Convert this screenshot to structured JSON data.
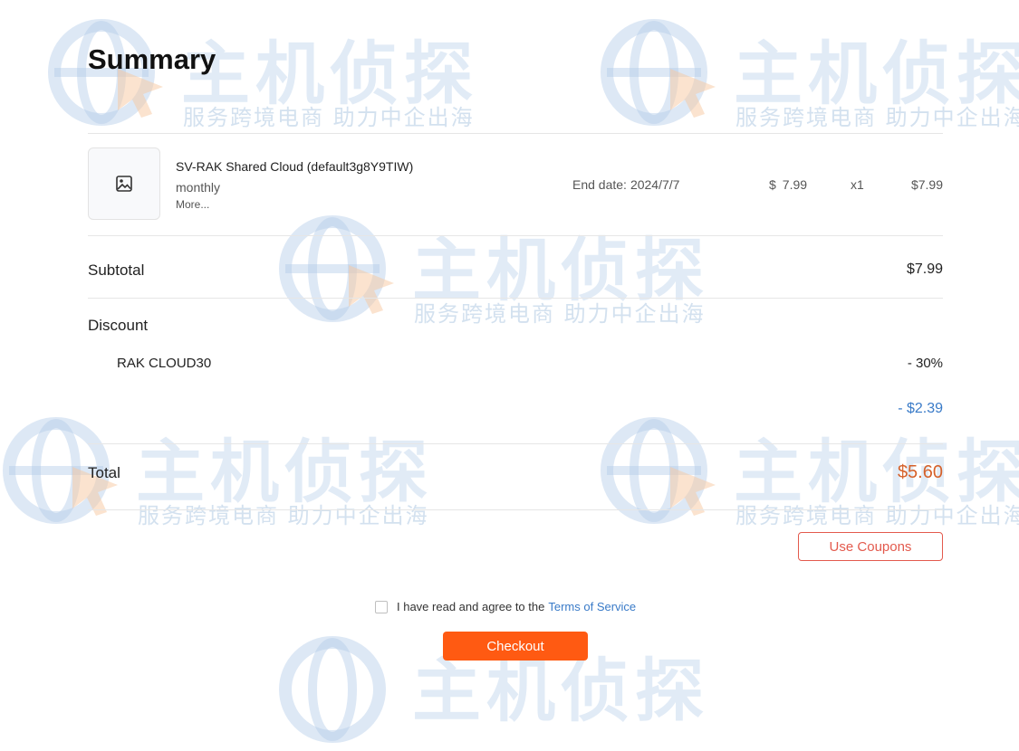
{
  "watermark": {
    "main": "主机侦探",
    "sub": "服务跨境电商 助力中企出海"
  },
  "page": {
    "title": "Summary"
  },
  "order_item": {
    "image_icon": "image-placeholder-icon",
    "name": "SV-RAK Shared Cloud (default3g8Y9TIW)",
    "billing_cycle": "monthly",
    "more_link": "More...",
    "end_date_label": "End date:",
    "end_date_value": "2024/7/7",
    "currency_symbol": "$",
    "unit_price": "7.99",
    "quantity": "x1",
    "line_total": "$7.99"
  },
  "subtotal": {
    "label": "Subtotal",
    "value": "$7.99"
  },
  "discount": {
    "label": "Discount",
    "coupon_code": "RAK CLOUD30",
    "coupon_value": "- 30%",
    "amount": "- $2.39"
  },
  "total": {
    "label": "Total",
    "value": "$5.60"
  },
  "actions": {
    "use_coupons": "Use Coupons",
    "agree_text": "I have read and agree to the",
    "terms_link": "Terms of Service",
    "checkout": "Checkout",
    "agree_checked": false
  },
  "colors": {
    "accent": "#ff5a12",
    "link": "#3a7bc8",
    "total": "#d5612a",
    "coupon_border": "#e35a4d"
  }
}
